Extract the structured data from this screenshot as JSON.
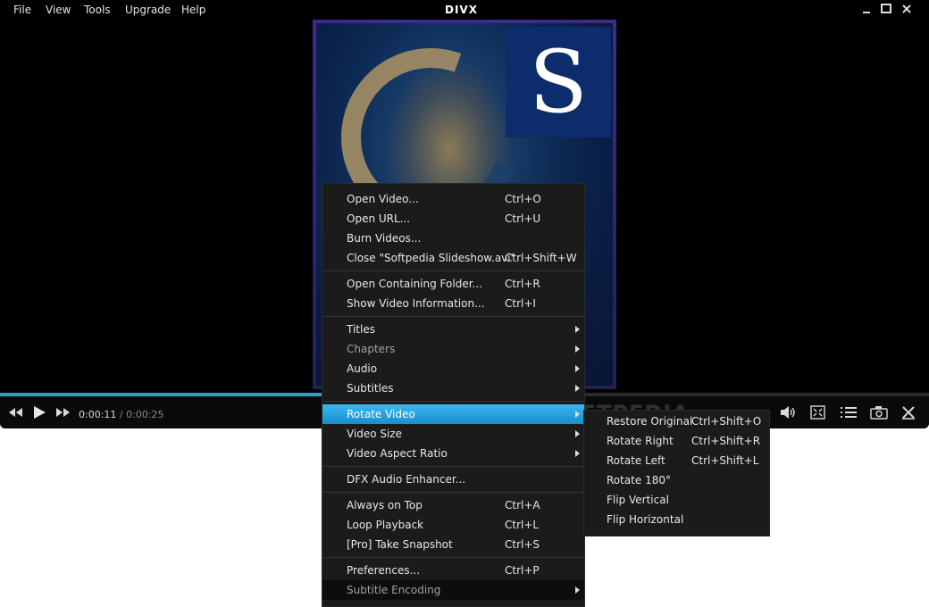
{
  "menubar": {
    "items": [
      {
        "label": "File"
      },
      {
        "label": "View"
      },
      {
        "label": "Tools"
      },
      {
        "label": "Upgrade"
      },
      {
        "label": "Help"
      }
    ],
    "logo": "DIVX"
  },
  "video": {
    "overlay_letter": "S"
  },
  "playback": {
    "current": "0:00:11",
    "separator": "/",
    "total": "0:00:25",
    "progress": 0.44
  },
  "context_menu": {
    "items": [
      {
        "label": "Open Video...",
        "shortcut": "Ctrl+O"
      },
      {
        "label": "Open URL...",
        "shortcut": "Ctrl+U"
      },
      {
        "label": "Burn Videos...",
        "shortcut": ""
      },
      {
        "label": "Close \"Softpedia Slideshow.avi\"",
        "shortcut": "Ctrl+Shift+W"
      },
      {
        "label": "Open Containing Folder...",
        "shortcut": "Ctrl+R"
      },
      {
        "label": "Show Video Information...",
        "shortcut": "Ctrl+I"
      },
      {
        "label": "Titles",
        "shortcut": ""
      },
      {
        "label": "Chapters",
        "shortcut": ""
      },
      {
        "label": "Audio",
        "shortcut": ""
      },
      {
        "label": "Subtitles",
        "shortcut": ""
      },
      {
        "label": "Rotate Video",
        "shortcut": ""
      },
      {
        "label": "Video Size",
        "shortcut": ""
      },
      {
        "label": "Video Aspect Ratio",
        "shortcut": ""
      },
      {
        "label": "DFX Audio Enhancer...",
        "shortcut": ""
      },
      {
        "label": "Always on Top",
        "shortcut": "Ctrl+A"
      },
      {
        "label": "Loop Playback",
        "shortcut": "Ctrl+L"
      },
      {
        "label": "[Pro] Take Snapshot",
        "shortcut": "Ctrl+S"
      },
      {
        "label": "Preferences...",
        "shortcut": "Ctrl+P"
      },
      {
        "label": "Subtitle Encoding",
        "shortcut": ""
      }
    ]
  },
  "submenu": {
    "items": [
      {
        "label": "Restore Original",
        "shortcut": "Ctrl+Shift+O"
      },
      {
        "label": "Rotate Right",
        "shortcut": "Ctrl+Shift+R"
      },
      {
        "label": "Rotate Left",
        "shortcut": "Ctrl+Shift+L"
      },
      {
        "label": "Rotate 180°",
        "shortcut": ""
      },
      {
        "label": "Flip Vertical",
        "shortcut": ""
      },
      {
        "label": "Flip Horizontal",
        "shortcut": ""
      }
    ]
  },
  "watermark": "SOFTPEDIA",
  "colors": {
    "accent": "#2a9fd8",
    "menu_bg": "#1b1b1b",
    "highlight": "#1ea0e0"
  }
}
